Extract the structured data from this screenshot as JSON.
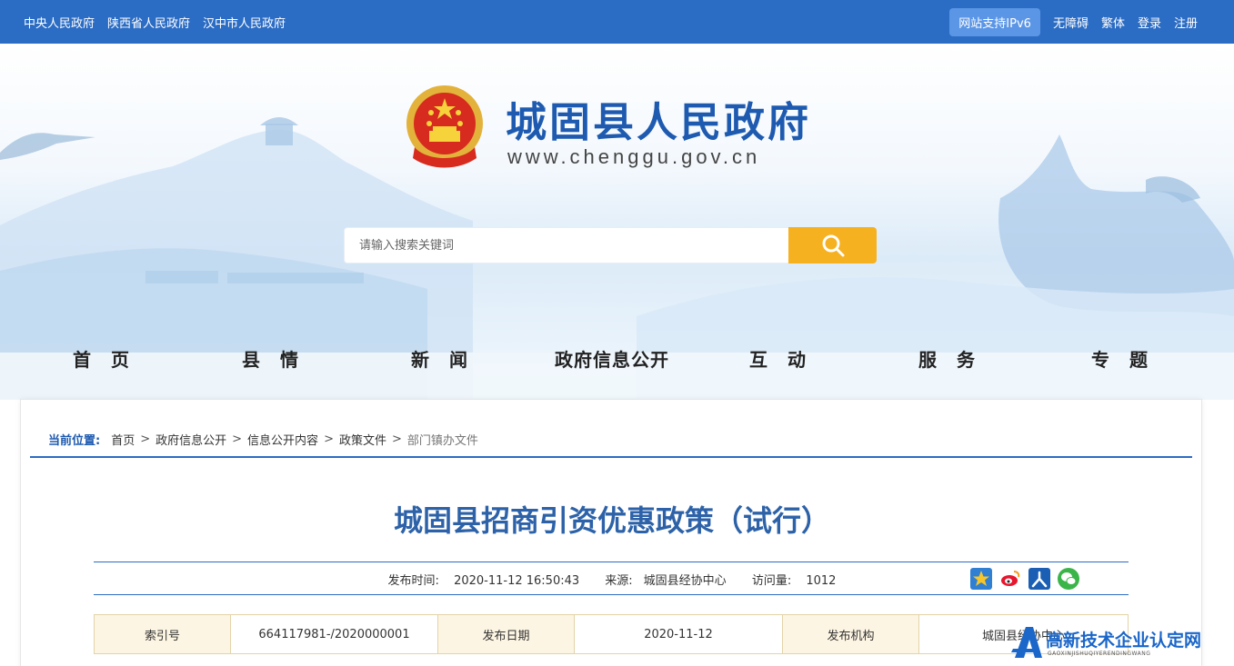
{
  "topbar": {
    "links": [
      "中央人民政府",
      "陕西省人民政府",
      "汉中市人民政府"
    ],
    "ipv6": "网站支持IPv6",
    "accessibility": "无障碍",
    "traditional": "繁体",
    "login": "登录",
    "register": "注册"
  },
  "header": {
    "site_name": "城固县人民政府",
    "site_url": "www.chenggu.gov.cn"
  },
  "search": {
    "placeholder": "请输入搜索关键词"
  },
  "nav": [
    "首　页",
    "县　情",
    "新　闻",
    "政府信息公开",
    "互　动",
    "服　务",
    "专　题"
  ],
  "breadcrumb": {
    "label": "当前位置:",
    "items": [
      "首页",
      "政府信息公开",
      "信息公开内容",
      "政策文件",
      "部门镇办文件"
    ],
    "separator": ">"
  },
  "article": {
    "title": "城固县招商引资优惠政策（试行）",
    "publish_time_label": "发布时间:",
    "publish_time": "2020-11-12 16:50:43",
    "source_label": "来源:",
    "source": "城固县经协中心",
    "visits_label": "访问量:",
    "visits": "1012"
  },
  "share": [
    "qzone-icon",
    "weibo-icon",
    "renren-icon",
    "wechat-icon"
  ],
  "info_table": {
    "index_label": "索引号",
    "index_value": "664117981-/2020000001",
    "date_label": "发布日期",
    "date_value": "2020-11-12",
    "org_label": "发布机构",
    "org_value": "城固县经协中心"
  },
  "watermark": {
    "text": "高新技术企业认定网",
    "sub": "GAOXINJISHUQIYERENDINGWANG"
  },
  "colors": {
    "primary": "#2b6cc4",
    "title": "#2d62a8",
    "search_button": "#f6b121"
  }
}
